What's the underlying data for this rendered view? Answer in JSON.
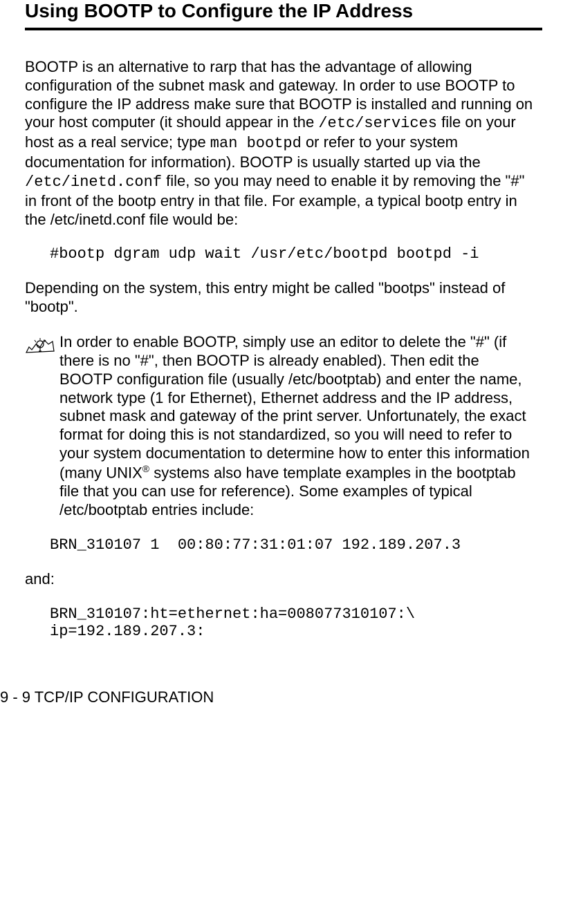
{
  "section": {
    "title": "Using BOOTP to Configure the IP Address"
  },
  "paragraphs": {
    "p1_part1": "BOOTP is an alternative to rarp that has the advantage of allowing configuration of the subnet mask and gateway. In order to use BOOTP to configure the IP address make sure that BOOTP is installed and running on your host computer (it should appear in the ",
    "p1_code1": "/etc/services",
    "p1_part2": " file on your host as a real service; type ",
    "p1_code2": "man bootpd",
    "p1_part3": " or refer to your system documentation for information). BOOTP is usually started up via the ",
    "p1_code3": "/etc/inetd.conf",
    "p1_part4": " file, so you may need to enable it by removing the \"#\" in front of the bootp entry in that file. For example, a typical bootp entry in the /etc/inetd.conf file would be:",
    "code_block_1": "#bootp dgram udp wait /usr/etc/bootpd bootpd -i",
    "p2": "Depending on the system, this entry might be called \"bootps\" instead of \"bootp\".",
    "note_part1": "In order to enable BOOTP, simply use an editor to delete the \"#\" (if there is no \"#\", then BOOTP is already enabled). Then edit the BOOTP configuration file (usually /etc/bootptab) and enter the name, network type (1 for Ethernet), Ethernet address and the IP address, subnet mask and gateway of the print server. Unfortunately, the exact format for doing this is not standardized, so you will need to refer to your system documentation to determine how to enter this information (many UNIX",
    "note_sup": "®",
    "note_part2": " systems also have template examples in the bootptab file that you can use for reference). Some examples of typical /etc/bootptab entries include:",
    "code_block_2": "BRN_310107 1  00:80:77:31:01:07 192.189.207.3",
    "and_label": "and:",
    "code_block_3": "BRN_310107:ht=ethernet:ha=008077310107:\\\nip=192.189.207.3:"
  },
  "footer": "9 - 9 TCP/IP CONFIGURATION"
}
